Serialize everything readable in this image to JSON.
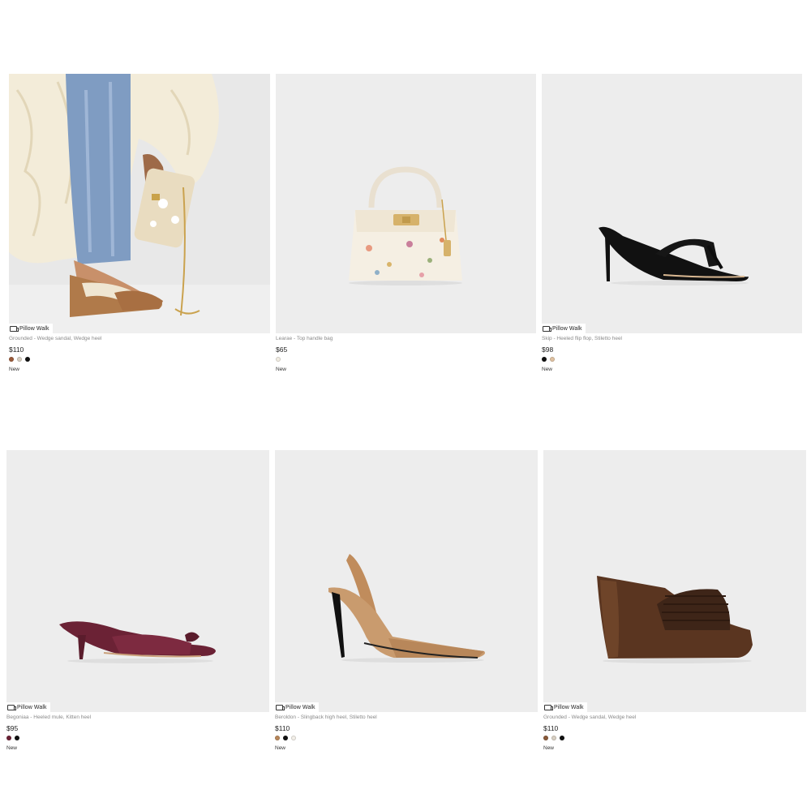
{
  "products": [
    {
      "badge": "Pillow Walk",
      "name": "Grounded - Wedge sandal, Wedge heel",
      "price": "$110",
      "swatches": [
        "#9a5a3a",
        "#d8cfc2",
        "#111111"
      ],
      "tag": "New",
      "image": "wedge-sandal-lifestyle"
    },
    {
      "badge": "",
      "name": "Learae - Top handle bag",
      "price": "$65",
      "swatches": [
        "#f1ece2"
      ],
      "tag": "New",
      "image": "floral-top-handle-bag"
    },
    {
      "badge": "Pillow Walk",
      "name": "Skip - Heeled flip flop, Stiletto heel",
      "price": "$98",
      "swatches": [
        "#111111",
        "#e0c2a2"
      ],
      "tag": "New",
      "image": "black-heeled-flip-flop"
    },
    {
      "badge": "Pillow Walk",
      "name": "Begoniaa - Heeled mule, Kitten heel",
      "price": "$95",
      "swatches": [
        "#6b2235",
        "#111111"
      ],
      "tag": "New",
      "image": "burgundy-kitten-mule"
    },
    {
      "badge": "Pillow Walk",
      "name": "Beroldon - Slingback high heel, Stiletto heel",
      "price": "$110",
      "swatches": [
        "#b8875a",
        "#111111",
        "#f3efe8"
      ],
      "tag": "New",
      "image": "tan-slingback-heel"
    },
    {
      "badge": "Pillow Walk",
      "name": "Grounded - Wedge sandal, Wedge heel",
      "price": "$110",
      "swatches": [
        "#8a5a3a",
        "#d8cfc2",
        "#111111"
      ],
      "tag": "New",
      "image": "brown-woven-wedge"
    }
  ]
}
